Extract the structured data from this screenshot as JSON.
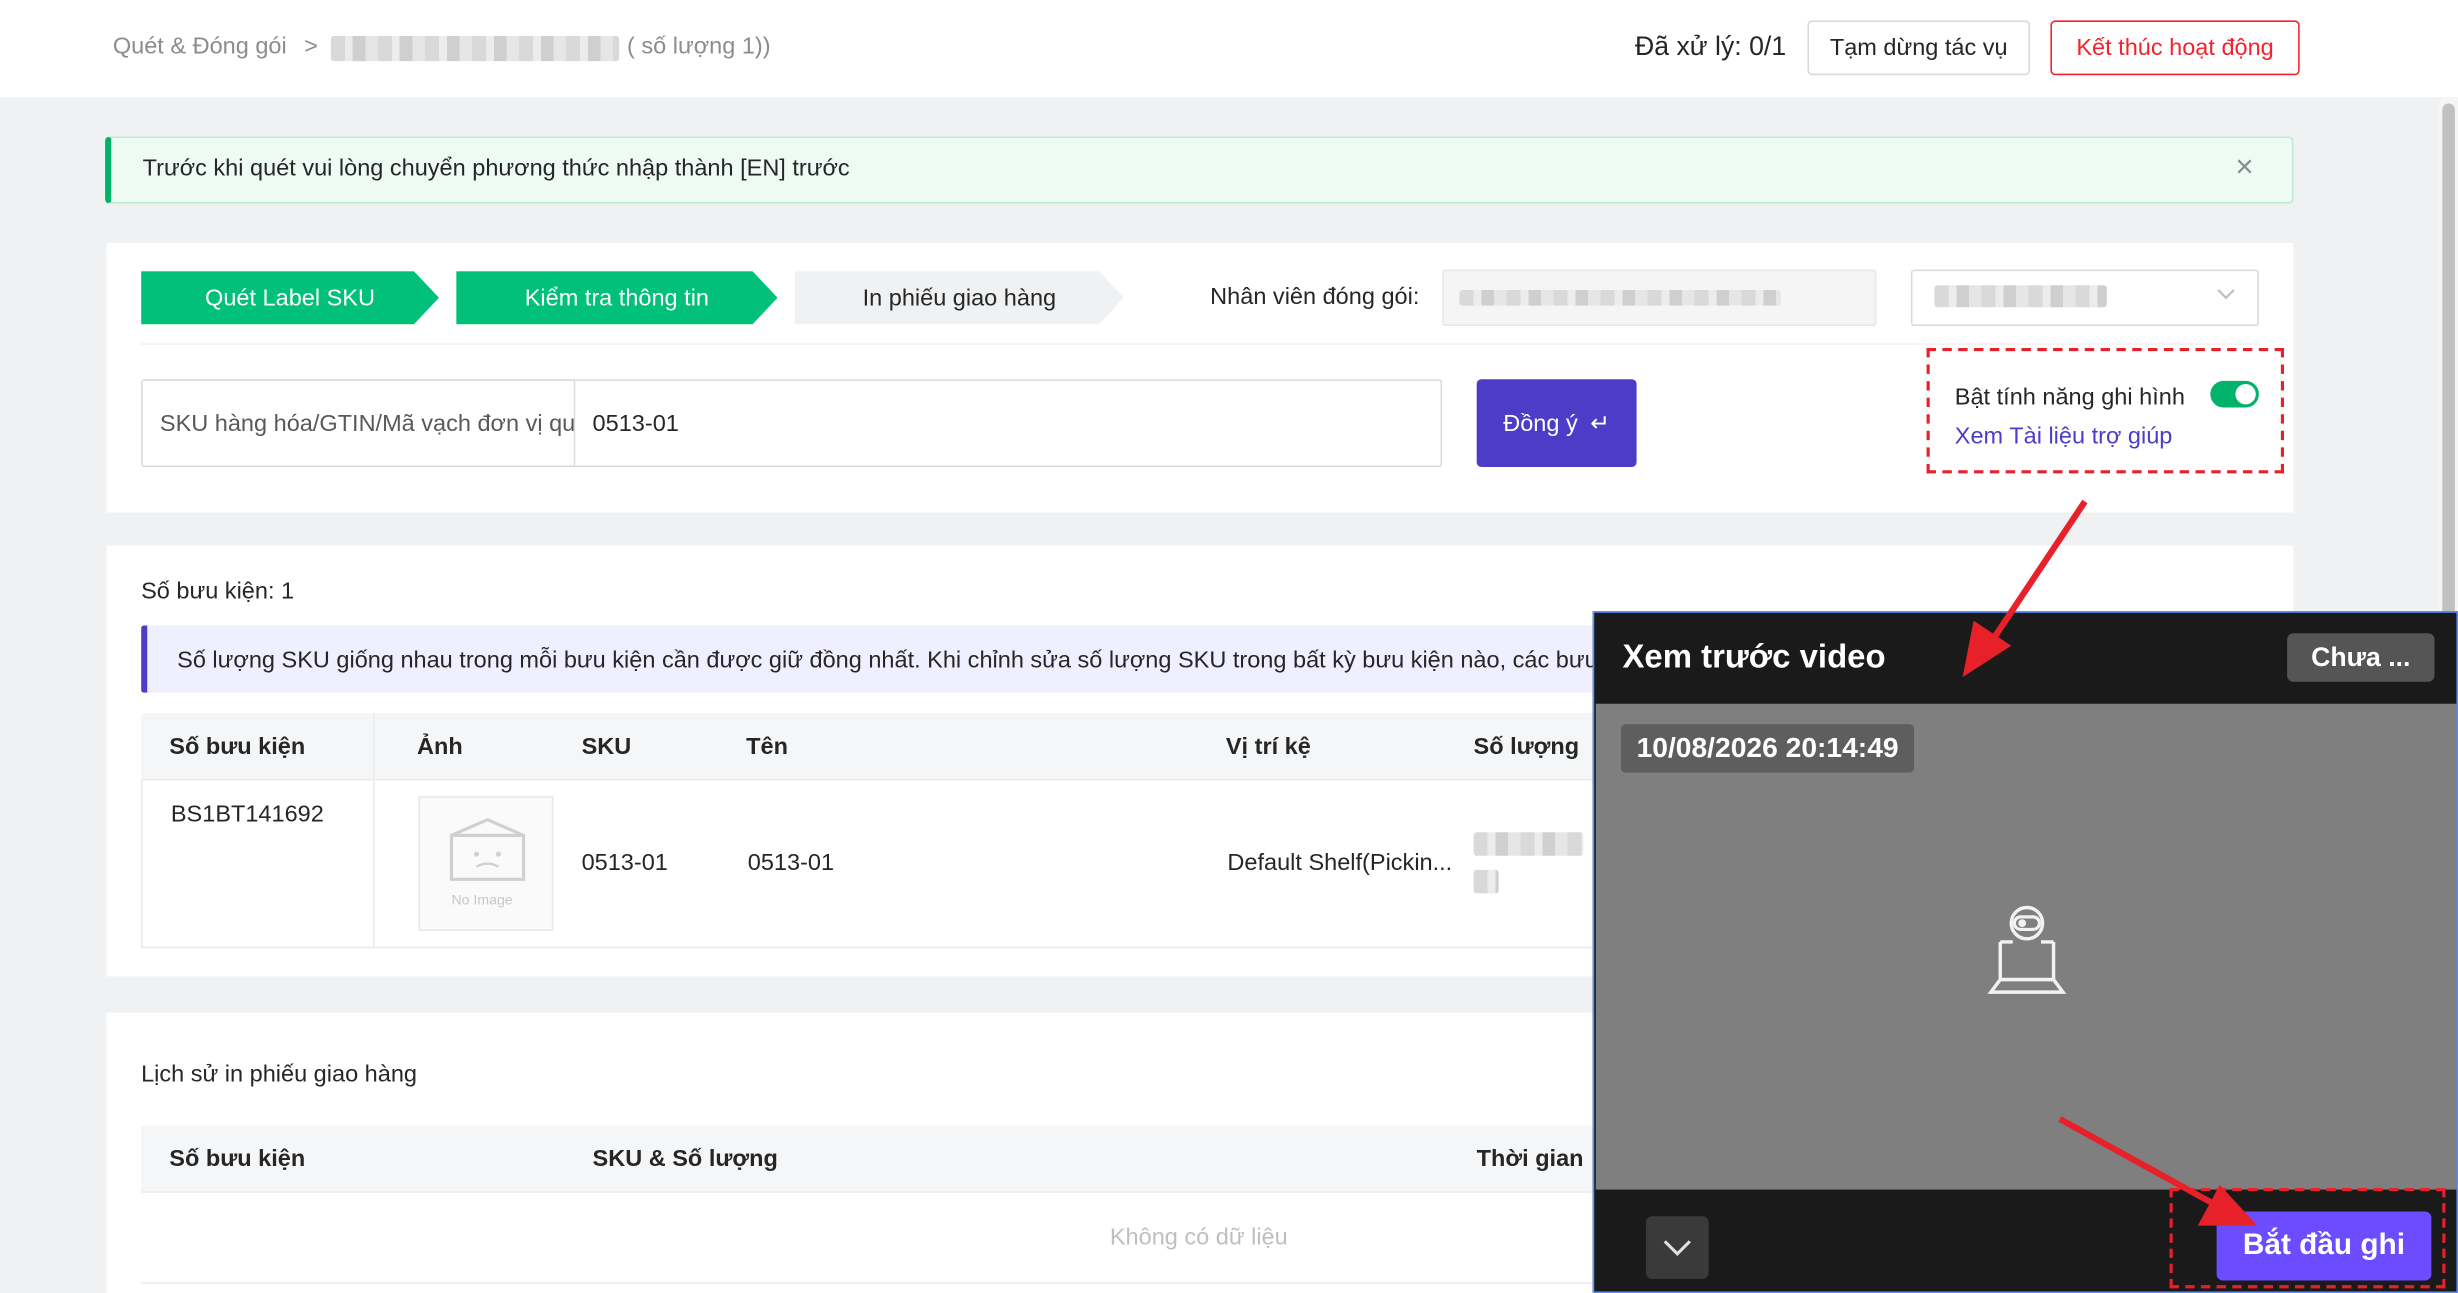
{
  "header": {
    "breadcrumb_root": "Quét & Đóng gói",
    "breadcrumb_separator": ">",
    "breadcrumb_quantity": "( số lượng 1))",
    "processed": "Đã xử lý: 0/1",
    "pause_button": "Tạm dừng tác vụ",
    "end_button": "Kết thúc hoạt động"
  },
  "alert": {
    "text": "Trước khi quét vui lòng chuyển phương thức nhập thành [EN] trước",
    "close": "×"
  },
  "steps": [
    {
      "label": "Quét Label SKU",
      "state": "done"
    },
    {
      "label": "Kiểm tra thông tin",
      "state": "done"
    },
    {
      "label": "In phiếu giao hàng",
      "state": "todo"
    }
  ],
  "packer": {
    "label": "Nhân viên đóng gói:"
  },
  "scan": {
    "type_label": "SKU hàng hóa/GTIN/Mã vạch đơn vị qu",
    "value": "0513-01",
    "ok_button": "Đồng ý",
    "ok_icon": "↵"
  },
  "recording": {
    "toggle_label": "Bật tính năng ghi hình",
    "toggle_on": true,
    "help_link": "Xem Tài liệu trợ giúp"
  },
  "parcels": {
    "count_label": "Số bưu kiện: 1",
    "notice": "Số lượng SKU giống nhau trong mỗi bưu kiện cần được giữ đồng nhất. Khi chỉnh sửa số lượng SKU trong bất kỳ bưu kiện nào, các bưu",
    "columns": [
      "Số bưu kiện",
      "Ảnh",
      "SKU",
      "Tên",
      "Vị trí kệ",
      "Số lượng"
    ],
    "rows": [
      {
        "parcel": "BS1BT141692",
        "image_text": "No Image",
        "sku": "0513-01",
        "name": "0513-01",
        "shelf": "Default Shelf(Pickin..."
      }
    ]
  },
  "history": {
    "title": "Lịch sử in phiếu giao hàng",
    "columns": [
      "Số bưu kiện",
      "SKU & Số lượng",
      "Thời gian"
    ],
    "empty": "Không có dữ liệu"
  },
  "video": {
    "title": "Xem trước video",
    "status": "Chưa ...",
    "timestamp": "10/08/2026 20:14:49",
    "start_button": "Bắt đầu ghi"
  },
  "colors": {
    "brand": "#4d3cc7",
    "step_done": "#00c07a",
    "danger": "#f5222d",
    "annotation": "#e8202a",
    "record_button": "#6c4cff"
  }
}
